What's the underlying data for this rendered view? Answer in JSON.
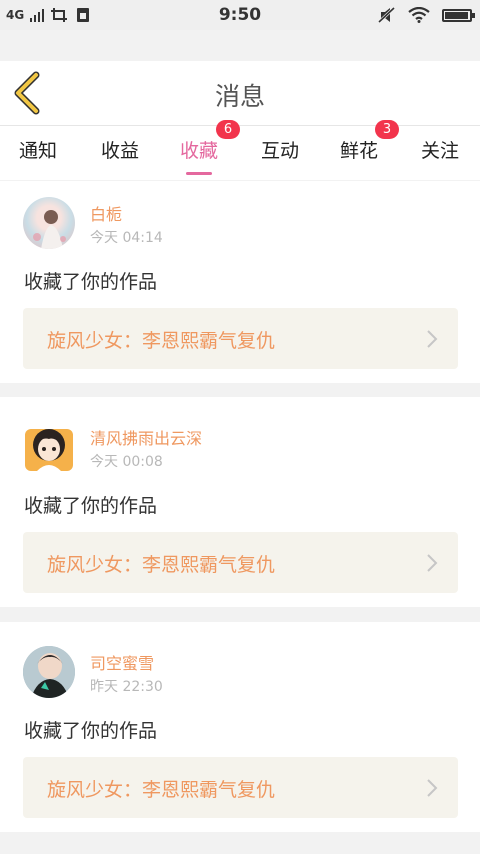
{
  "status_bar": {
    "network": "4G",
    "time": "9:50",
    "icons": [
      "signal-bars-icon",
      "screenshot-icon",
      "sim-card-icon",
      "mute-icon",
      "wifi-icon",
      "battery-icon"
    ],
    "battery_level": 0.95
  },
  "header": {
    "title": "消息",
    "back_icon": "chevron-left-icon",
    "back_color": "#f2c744"
  },
  "tabs": [
    {
      "label": "通知",
      "badge": ""
    },
    {
      "label": "收益",
      "badge": ""
    },
    {
      "label": "收藏",
      "badge": "6",
      "active": true
    },
    {
      "label": "互动",
      "badge": ""
    },
    {
      "label": "鲜花",
      "badge": "3"
    },
    {
      "label": "关注",
      "badge": ""
    }
  ],
  "messages": [
    {
      "user": "白栀",
      "time": "今天 04:14",
      "action": "收藏了你的作品",
      "work_title": "旋风少女：李恩熙霸气复仇"
    },
    {
      "user": "清风拂雨出云深",
      "time": "今天 00:08",
      "action": "收藏了你的作品",
      "work_title": "旋风少女：李恩熙霸气复仇"
    },
    {
      "user": "司空蜜雪",
      "time": "昨天 22:30",
      "action": "收藏了你的作品",
      "work_title": "旋风少女：李恩熙霸气复仇"
    }
  ],
  "colors": {
    "accent": "#e4689e",
    "username": "#ef9860",
    "badge": "#f2344c",
    "work_bg": "#f5f3ec"
  }
}
